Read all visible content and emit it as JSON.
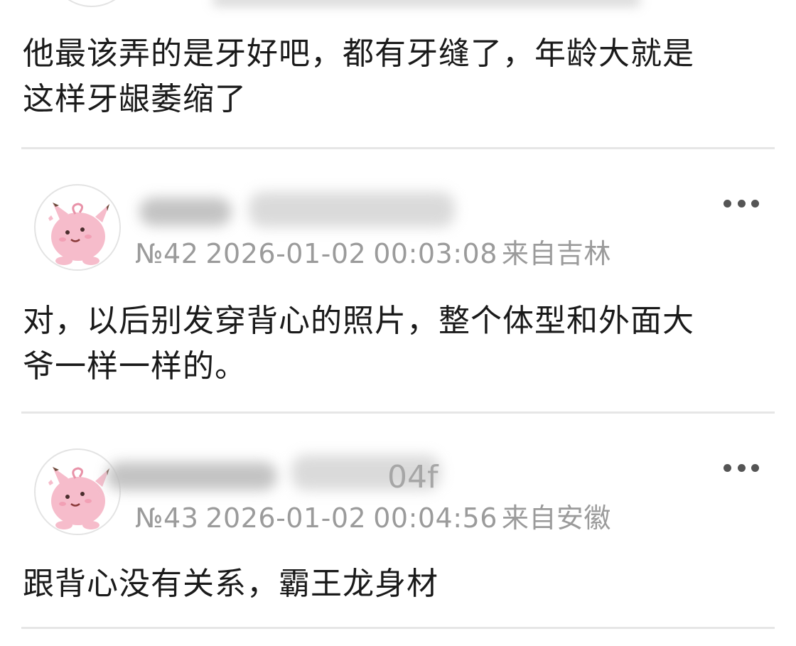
{
  "colors": {
    "text": "#1a1a1a",
    "meta": "#9b9b9b",
    "divider": "#e6e6e6",
    "avatar_pink": "#f6bccb"
  },
  "top_post": {
    "content": "他最该弄的是牙好吧，都有牙缝了，年龄大就是\n这样牙龈萎缩了"
  },
  "posts": [
    {
      "floor": "№42",
      "date": "2026-01-02",
      "time": "00:03:08",
      "location": "来自吉林",
      "name_visible": "",
      "content": "对，以后别发穿背心的照片，整个体型和外面大\n爷一样一样的。",
      "avatar_icon": "clefairy-avatar-icon",
      "more_icon": "more-options-icon"
    },
    {
      "floor": "№43",
      "date": "2026-01-02",
      "time": "00:04:56",
      "location": "来自安徽",
      "name_visible": "04f",
      "content": "跟背心没有关系，霸王龙身材",
      "avatar_icon": "clefairy-avatar-icon",
      "more_icon": "more-options-icon"
    }
  ]
}
